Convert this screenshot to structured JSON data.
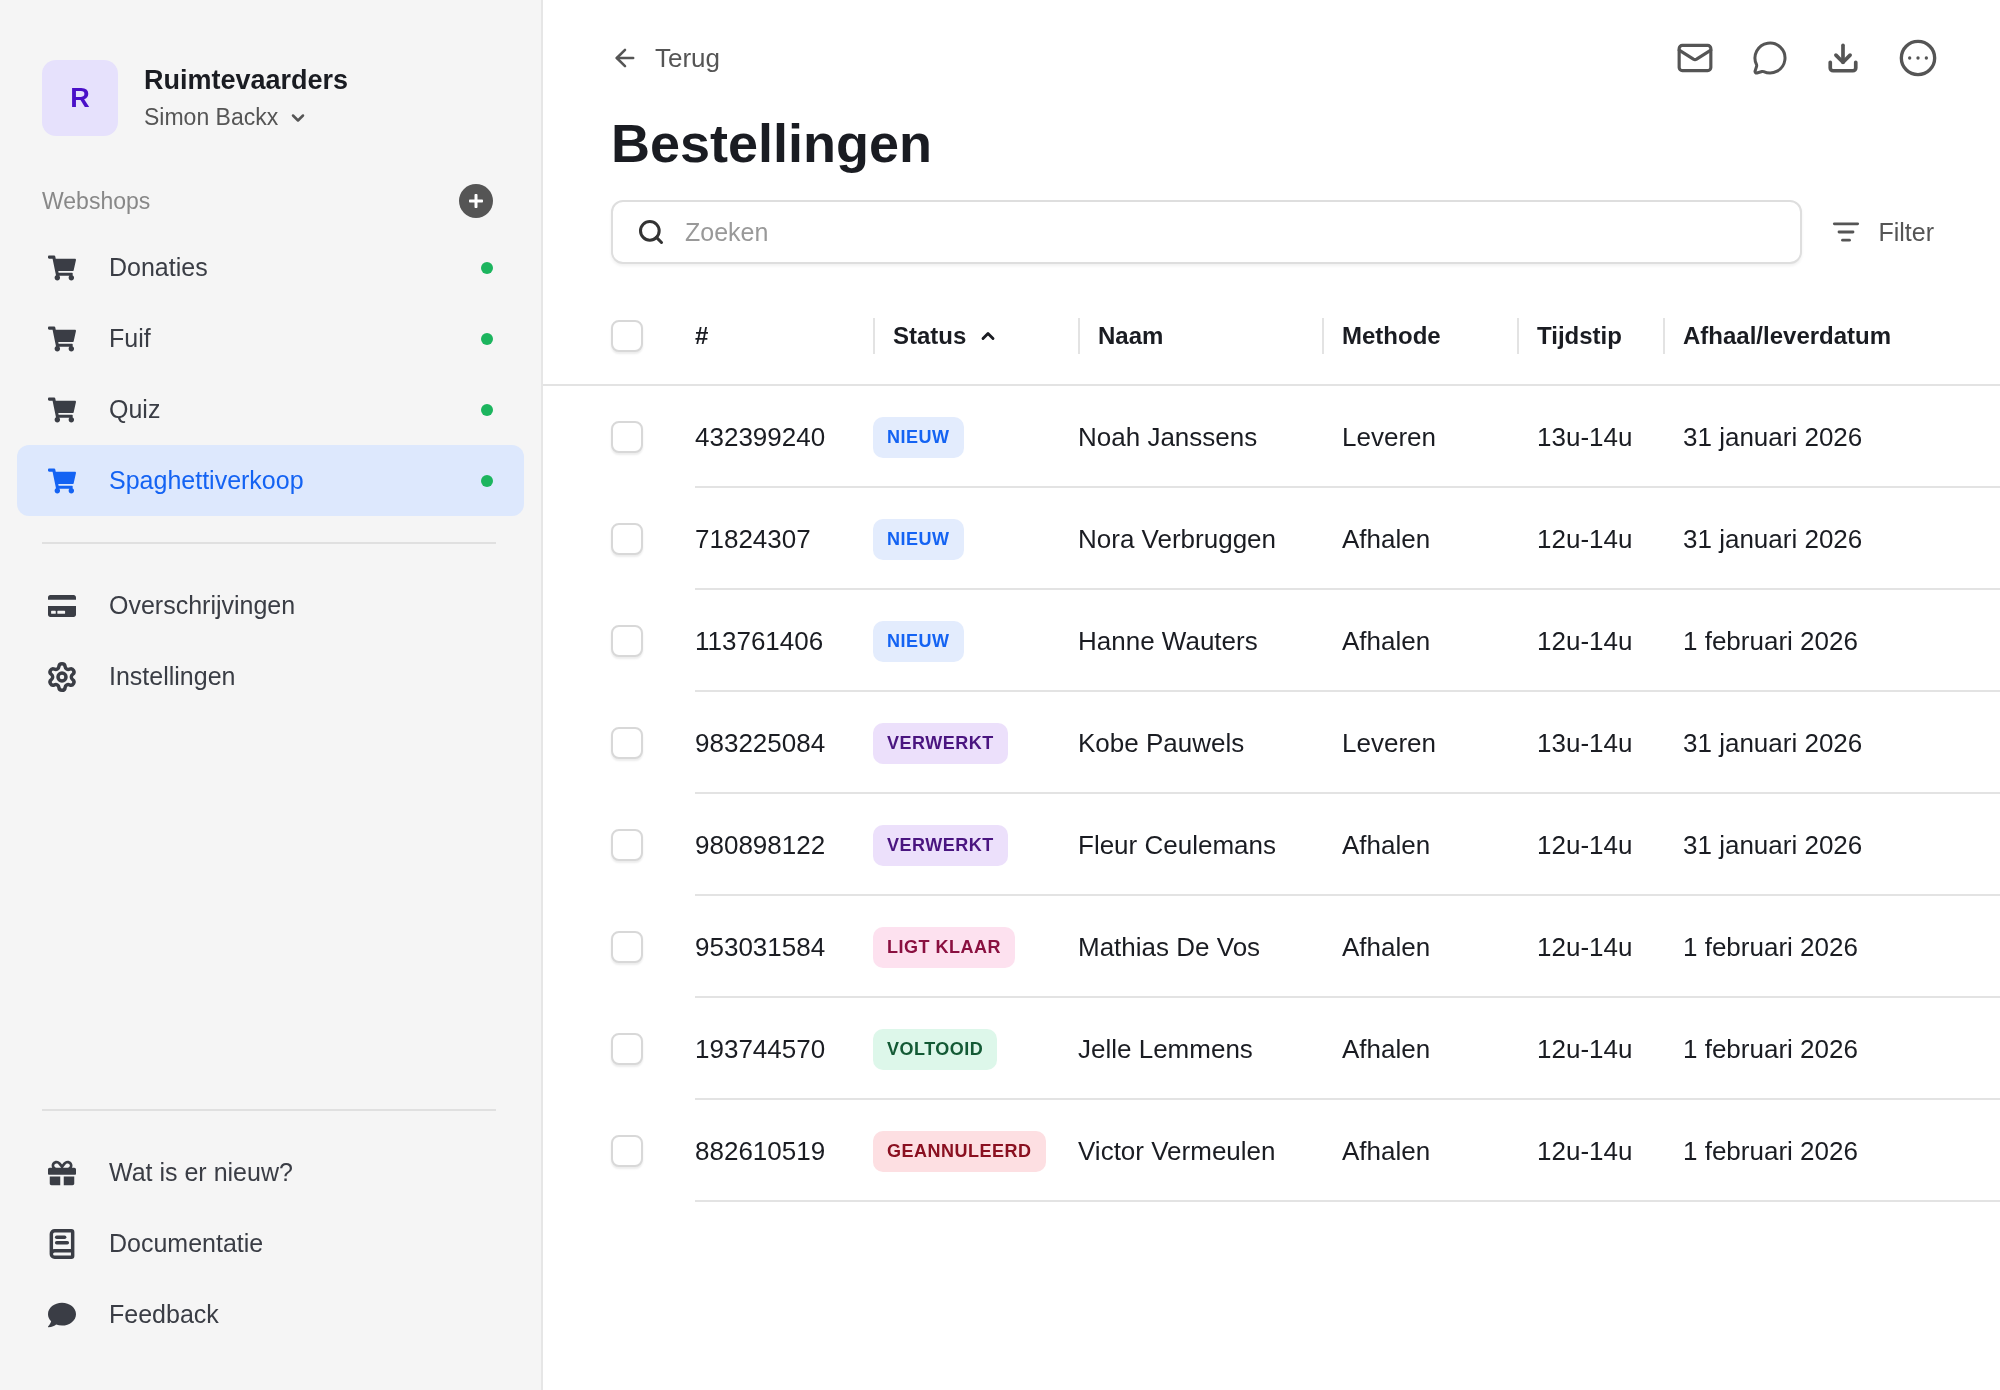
{
  "sidebar": {
    "org": {
      "initial": "R",
      "name": "Ruimtevaarders",
      "user": "Simon Backx"
    },
    "section_title": "Webshops",
    "webshops": [
      {
        "label": "Donaties",
        "selected": false,
        "color": "#1cb55e"
      },
      {
        "label": "Fuif",
        "selected": false,
        "color": "#1cb55e"
      },
      {
        "label": "Quiz",
        "selected": false,
        "color": "#1cb55e"
      },
      {
        "label": "Spaghettiverkoop",
        "selected": true,
        "color": "#1cb55e"
      }
    ],
    "menu": [
      {
        "kind": "card",
        "label": "Overschrijvingen"
      },
      {
        "kind": "gear",
        "label": "Instellingen"
      }
    ],
    "footer": [
      {
        "kind": "gift",
        "label": "Wat is er nieuw?"
      },
      {
        "kind": "book",
        "label": "Documentatie"
      },
      {
        "kind": "chat",
        "label": "Feedback"
      }
    ]
  },
  "main": {
    "back": "Terug",
    "title": "Bestellingen",
    "search": {
      "placeholder": "Zoeken"
    },
    "filter": "Filter",
    "table": {
      "all_checked": false,
      "columns": [
        {
          "label": "#",
          "sorted": false
        },
        {
          "label": "Status",
          "sorted": true
        },
        {
          "label": "Naam",
          "sorted": false
        },
        {
          "label": "Methode",
          "sorted": false
        },
        {
          "label": "Tijdstip",
          "sorted": false
        },
        {
          "label": "Afhaal/leverdatum",
          "sorted": false
        }
      ],
      "rows": [
        {
          "checked": false,
          "number": "432399240",
          "status": {
            "label": "NIEUW",
            "kind": "new"
          },
          "name": "Noah Janssens",
          "method": "Leveren",
          "time": "13u-14u",
          "date": "31 januari 2026"
        },
        {
          "checked": false,
          "number": "71824307",
          "status": {
            "label": "NIEUW",
            "kind": "new"
          },
          "name": "Nora Verbruggen",
          "method": "Afhalen",
          "time": "12u-14u",
          "date": "31 januari 2026"
        },
        {
          "checked": false,
          "number": "113761406",
          "status": {
            "label": "NIEUW",
            "kind": "new"
          },
          "name": "Hanne Wauters",
          "method": "Afhalen",
          "time": "12u-14u",
          "date": "1 februari 2026"
        },
        {
          "checked": false,
          "number": "983225084",
          "status": {
            "label": "VERWERKT",
            "kind": "processed"
          },
          "name": "Kobe Pauwels",
          "method": "Leveren",
          "time": "13u-14u",
          "date": "31 januari 2026"
        },
        {
          "checked": false,
          "number": "980898122",
          "status": {
            "label": "VERWERKT",
            "kind": "processed"
          },
          "name": "Fleur Ceulemans",
          "method": "Afhalen",
          "time": "12u-14u",
          "date": "31 januari 2026"
        },
        {
          "checked": false,
          "number": "953031584",
          "status": {
            "label": "LIGT KLAAR",
            "kind": "ready"
          },
          "name": "Mathias De Vos",
          "method": "Afhalen",
          "time": "12u-14u",
          "date": "1 februari 2026"
        },
        {
          "checked": false,
          "number": "193744570",
          "status": {
            "label": "VOLTOOID",
            "kind": "done"
          },
          "name": "Jelle Lemmens",
          "method": "Afhalen",
          "time": "12u-14u",
          "date": "1 februari 2026"
        },
        {
          "checked": false,
          "number": "882610519",
          "status": {
            "label": "GEANNULEERD",
            "kind": "cancelled"
          },
          "name": "Victor Vermeulen",
          "method": "Afhalen",
          "time": "12u-14u",
          "date": "1 februari 2026"
        }
      ]
    }
  }
}
